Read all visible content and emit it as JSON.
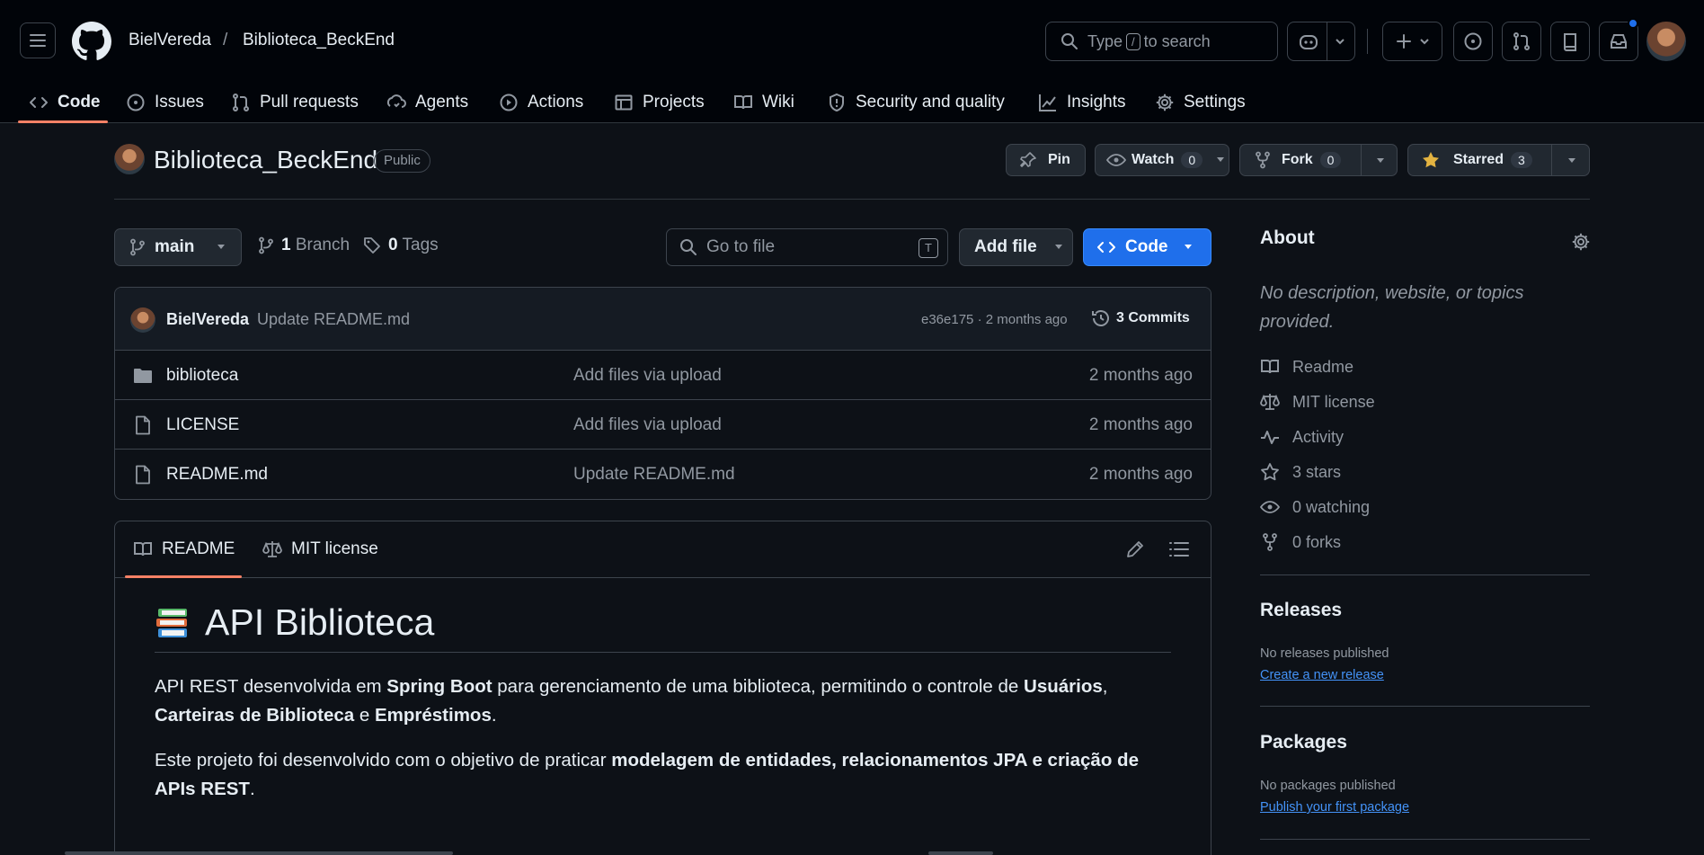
{
  "header": {
    "owner": "BielVereda",
    "separator": "/",
    "repo": "Biblioteca_BeckEnd",
    "search": {
      "prefix": "Type",
      "key": "/",
      "suffix": "to search"
    }
  },
  "nav": {
    "items": [
      {
        "label": "Code",
        "icon": "code-icon"
      },
      {
        "label": "Issues",
        "icon": "issue-icon"
      },
      {
        "label": "Pull requests",
        "icon": "pull-request-icon"
      },
      {
        "label": "Agents",
        "icon": "agents-icon"
      },
      {
        "label": "Actions",
        "icon": "play-icon"
      },
      {
        "label": "Projects",
        "icon": "table-icon"
      },
      {
        "label": "Wiki",
        "icon": "book-icon"
      },
      {
        "label": "Security and quality",
        "icon": "shield-icon"
      },
      {
        "label": "Insights",
        "icon": "graph-icon"
      },
      {
        "label": "Settings",
        "icon": "gear-icon"
      }
    ]
  },
  "repo": {
    "title": "Biblioteca_BeckEnd",
    "visibility": "Public",
    "pin": "Pin",
    "watch": "Watch",
    "watch_count": "0",
    "fork": "Fork",
    "fork_count": "0",
    "starred": "Starred",
    "star_count": "3"
  },
  "branchbar": {
    "branch": "main",
    "branches_count": "1",
    "branches_label": "Branch",
    "tags_count": "0",
    "tags_label": "Tags",
    "goto_placeholder": "Go to file",
    "goto_key": "T",
    "add_file": "Add file",
    "code": "Code"
  },
  "commit": {
    "author": "BielVereda",
    "message": "Update README.md",
    "sha_time": "e36e175 · 2 months ago",
    "commits": "3 Commits"
  },
  "files": [
    {
      "name": "biblioteca",
      "type": "folder",
      "message": "Add files via upload",
      "time": "2 months ago"
    },
    {
      "name": "LICENSE",
      "type": "file",
      "message": "Add files via upload",
      "time": "2 months ago"
    },
    {
      "name": "README.md",
      "type": "file",
      "message": "Update README.md",
      "time": "2 months ago"
    }
  ],
  "readme": {
    "tab_readme": "README",
    "tab_license": "MIT license",
    "title": "API Biblioteca",
    "p1": {
      "t1": "API REST desenvolvida em ",
      "b1": "Spring Boot",
      "t2": " para gerenciamento de uma biblioteca, permitindo o controle de ",
      "b2": "Usuários",
      "t3": ", ",
      "b3": "Carteiras de Biblioteca",
      "t4": " e ",
      "b4": "Empréstimos",
      "t5": "."
    },
    "p2": {
      "t1": "Este projeto foi desenvolvido com o objetivo de praticar ",
      "b1": "modelagem de entidades, relacionamentos JPA e criação de APIs REST",
      "t2": "."
    }
  },
  "sidebar": {
    "about_title": "About",
    "about_desc": "No description, website, or topics provided.",
    "items": [
      {
        "label": "Readme",
        "icon": "book-icon"
      },
      {
        "label": "MIT license",
        "icon": "scale-icon"
      },
      {
        "label": "Activity",
        "icon": "pulse-icon"
      },
      {
        "label": "3 stars",
        "icon": "star-icon"
      },
      {
        "label": "0 watching",
        "icon": "eye-icon"
      },
      {
        "label": "0 forks",
        "icon": "fork-icon"
      }
    ],
    "releases_title": "Releases",
    "releases_none": "No releases published",
    "releases_link": "Create a new release",
    "packages_title": "Packages",
    "packages_none": "No packages published",
    "packages_link": "Publish your first package"
  },
  "colors": {
    "background": "#0d1117",
    "header": "#010409",
    "accent_blue": "#1f6feb",
    "underline": "#f78166",
    "star": "#e3b341",
    "muted": "#9198a1"
  }
}
